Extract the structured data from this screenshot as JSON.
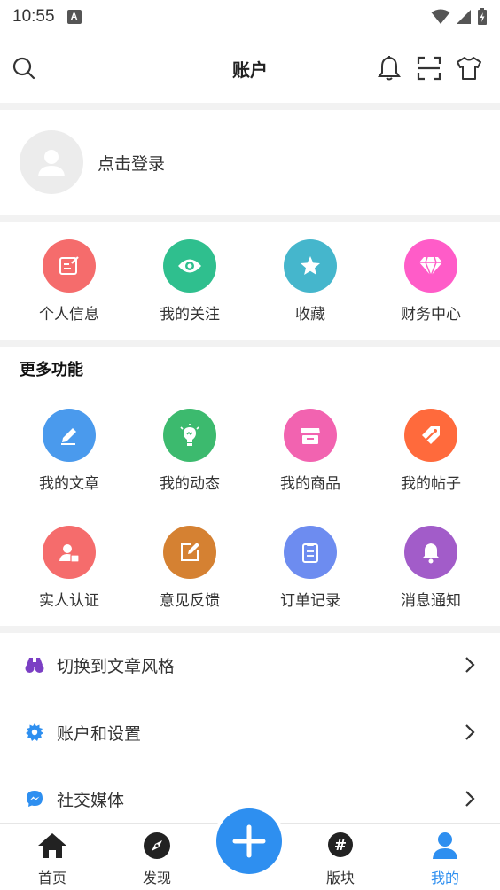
{
  "status_bar": {
    "time": "10:55",
    "notif_letter": "A"
  },
  "header": {
    "title": "账户",
    "icons": [
      "search-icon",
      "bell-icon",
      "scan-icon",
      "tshirt-icon"
    ]
  },
  "login": {
    "prompt": "点击登录"
  },
  "quick_actions": [
    {
      "label": "个人信息",
      "color": "#f56c6c",
      "icon": "edit-icon"
    },
    {
      "label": "我的关注",
      "color": "#2fbf8e",
      "icon": "eye-icon"
    },
    {
      "label": "收藏",
      "color": "#45b6cc",
      "icon": "star-icon"
    },
    {
      "label": "财务中心",
      "color": "#ff5cc8",
      "icon": "diamond-icon"
    }
  ],
  "more": {
    "title": "更多功能",
    "items": [
      {
        "label": "我的文章",
        "color": "#4a9aed",
        "icon": "pen-icon"
      },
      {
        "label": "我的动态",
        "color": "#3cba6e",
        "icon": "bulb-icon"
      },
      {
        "label": "我的商品",
        "color": "#f263b0",
        "icon": "shop-icon"
      },
      {
        "label": "我的帖子",
        "color": "#ff6a3c",
        "icon": "tag-icon"
      },
      {
        "label": "实人认证",
        "color": "#f56c6c",
        "icon": "id-card-icon"
      },
      {
        "label": "意见反馈",
        "color": "#d58132",
        "icon": "feedback-icon"
      },
      {
        "label": "订单记录",
        "color": "#6d8cf0",
        "icon": "clipboard-icon"
      },
      {
        "label": "消息通知",
        "color": "#a25cc9",
        "icon": "bell-icon"
      }
    ]
  },
  "menu": [
    {
      "label": "切换到文章风格",
      "icon": "binoculars-icon",
      "color": "#7b3fc4"
    },
    {
      "label": "账户和设置",
      "icon": "gear-icon",
      "color": "#2e8ff0"
    },
    {
      "label": "社交媒体",
      "icon": "messenger-icon",
      "color": "#2e8ff0"
    }
  ],
  "tabbar": {
    "tabs": [
      {
        "label": "首页",
        "icon": "home-icon"
      },
      {
        "label": "发现",
        "icon": "compass-icon"
      },
      {
        "label": "版块",
        "icon": "hashtag-icon"
      },
      {
        "label": "我的",
        "icon": "user-icon"
      }
    ],
    "active": "我的",
    "fab_icon": "plus-icon",
    "accent": "#2e8ff0"
  }
}
